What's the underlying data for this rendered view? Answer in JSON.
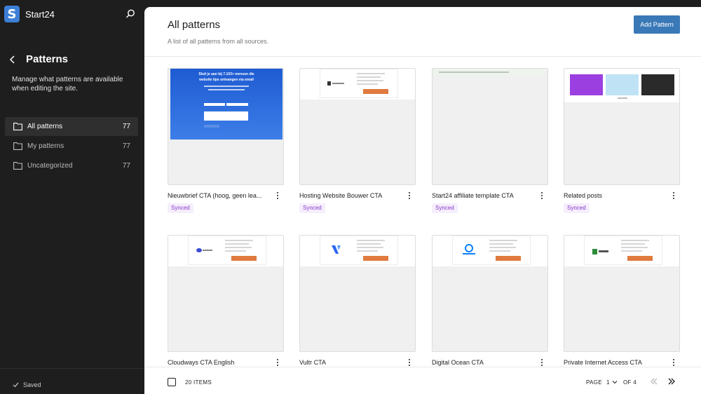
{
  "sidebar": {
    "site_name": "Start24",
    "logo_letter": "S",
    "title": "Patterns",
    "description": "Manage what patterns are available when editing the site.",
    "items": [
      {
        "label": "All patterns",
        "count": "77"
      },
      {
        "label": "My patterns",
        "count": "77"
      },
      {
        "label": "Uncategorized",
        "count": "77"
      }
    ],
    "saved": "Saved"
  },
  "header": {
    "title": "All patterns",
    "subtitle": "A list of all patterns from all sources.",
    "add_button": "Add Pattern"
  },
  "cards": [
    {
      "name": "Nieuwbrief CTA (hoog, geen lea...",
      "badge": "Synced"
    },
    {
      "name": "Hosting Website Bouwer CTA",
      "badge": "Synced"
    },
    {
      "name": "Start24 affiliate template CTA",
      "badge": "Synced"
    },
    {
      "name": "Related posts",
      "badge": "Synced"
    },
    {
      "name": "Cloudways CTA English"
    },
    {
      "name": "Vultr CTA"
    },
    {
      "name": "Digital Ocean CTA"
    },
    {
      "name": "Private Internet Access CTA"
    }
  ],
  "thumb_text": {
    "newsletter_heading_1": "Sluit je aan bij 7.103+ mensen die",
    "newsletter_heading_2": "website tips ontvangen via email"
  },
  "footer": {
    "items_count": "20 ITEMS",
    "page_label": "PAGE",
    "page_number": "1",
    "of_label": "OF 4"
  },
  "icons": {
    "search": "search-icon",
    "back": "chevron-left-icon",
    "folder": "folder-icon",
    "more": "more-vertical-icon",
    "check": "check-icon"
  },
  "colors": {
    "accent": "#3a79b7",
    "sidebar_bg": "#1e1e1e",
    "badge_text": "#8a36c8",
    "badge_bg": "#f5eefc",
    "cta_orange": "#e07a3e"
  }
}
